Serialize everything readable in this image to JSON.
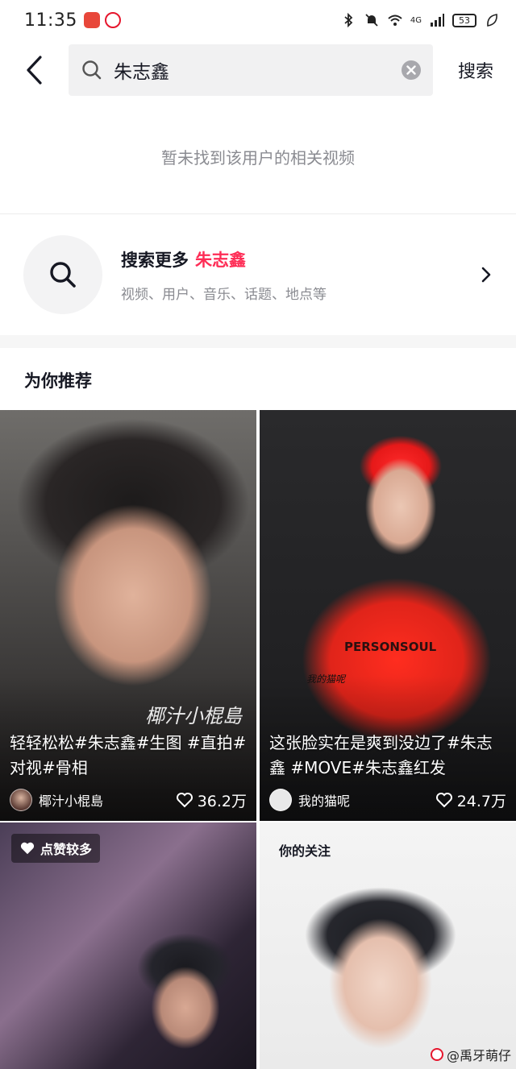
{
  "status_bar": {
    "time": "11:35",
    "battery": "53",
    "network": "4G"
  },
  "search": {
    "query": "朱志鑫",
    "button_label": "搜索"
  },
  "empty_message": "暂未找到该用户的相关视频",
  "search_more": {
    "label": "搜索更多",
    "keyword": "朱志鑫",
    "subtitle": "视频、用户、音乐、话题、地点等"
  },
  "recommend": {
    "title": "为你推荐",
    "cards": [
      {
        "title": "轻轻松松#朱志鑫#生图 #直拍#对视#骨相",
        "author": "椰汁小棍島",
        "likes": "36.2万",
        "watermark": "椰汁小棍島"
      },
      {
        "title": "这张脸实在是爽到没边了#朱志鑫 #MOVE#朱志鑫红发",
        "author": "我的猫呢",
        "likes": "24.7万",
        "watermark": "我的猫呢",
        "jersey_text": "PERSONSOUL"
      },
      {
        "tag": "点赞较多"
      },
      {
        "tag": "你的关注",
        "corner_watermark": "@禹牙萌仔"
      }
    ]
  },
  "colors": {
    "accent": "#fe2c55",
    "text_primary": "#161823",
    "text_secondary": "#8a8b91"
  }
}
